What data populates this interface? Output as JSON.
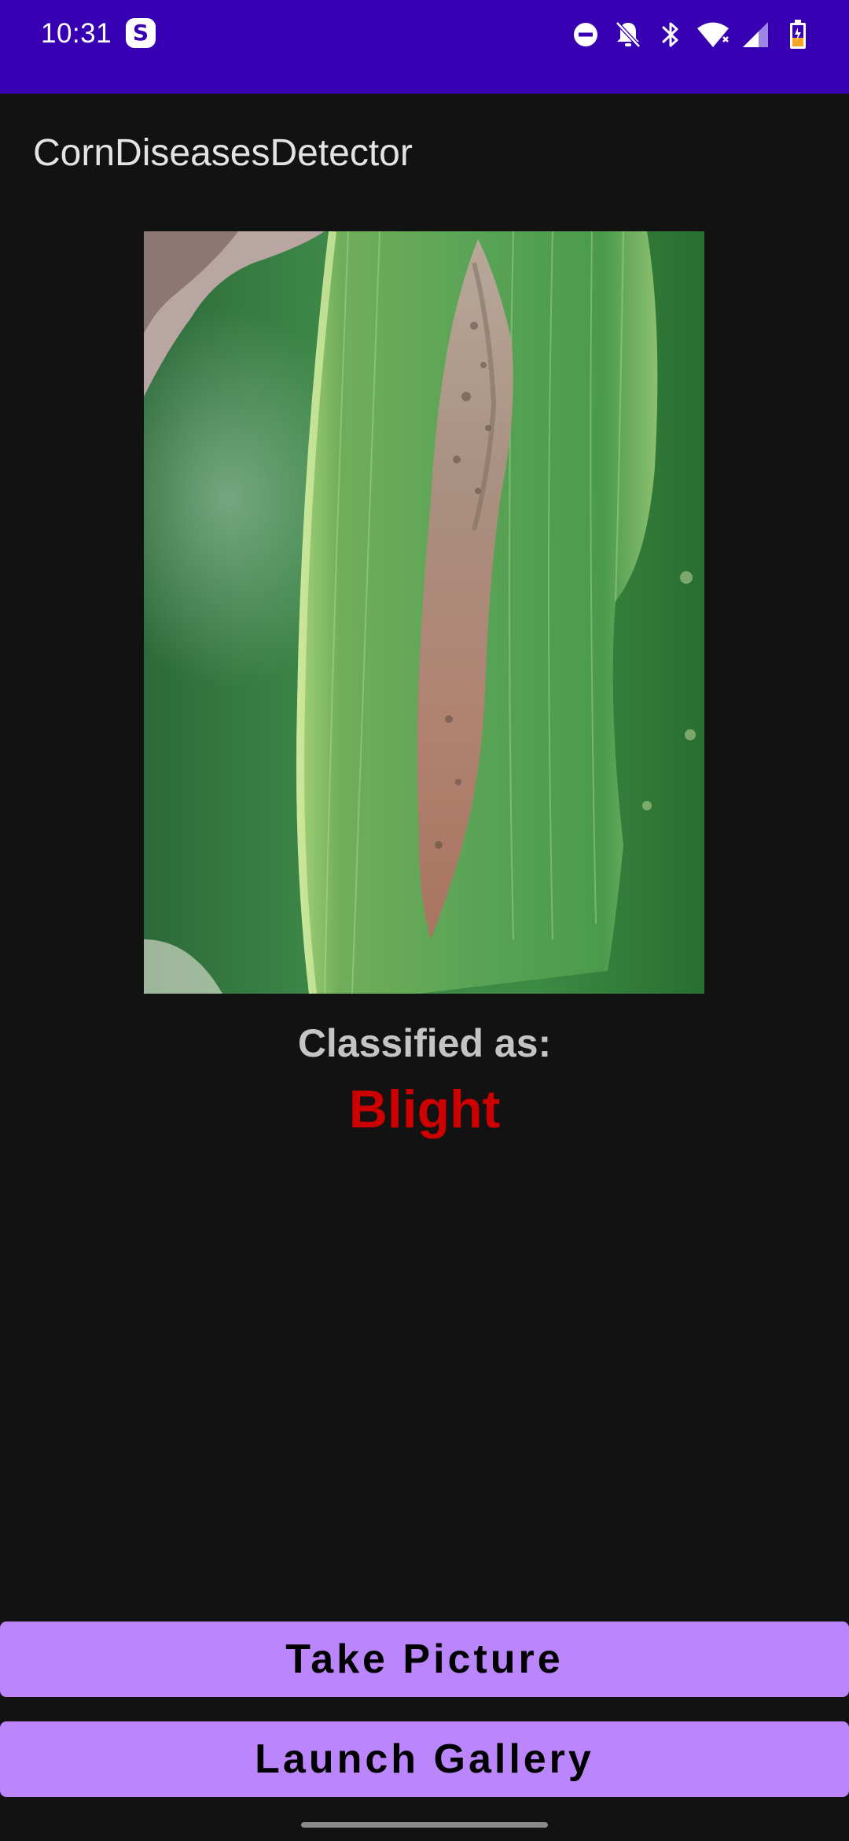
{
  "colors": {
    "statusbar": "#3700B3",
    "background": "#121212",
    "title_text": "#E3E3E3",
    "label_text": "#C4C4C4",
    "result_text": "#CC0000",
    "button_bg": "#BB86FC",
    "button_text": "#000000"
  },
  "status_bar": {
    "time": "10:31",
    "icons": [
      "skype-icon",
      "do-not-disturb-icon",
      "notifications-off-icon",
      "bluetooth-icon",
      "wifi-icon",
      "cell-signal-icon",
      "battery-charging-icon"
    ]
  },
  "app": {
    "title": "CornDiseasesDetector"
  },
  "image": {
    "subject": "corn-leaf-photo"
  },
  "result": {
    "label": "Classified as:",
    "value": "Blight"
  },
  "buttons": {
    "take_picture": "Take Picture",
    "launch_gallery": "Launch Gallery"
  }
}
